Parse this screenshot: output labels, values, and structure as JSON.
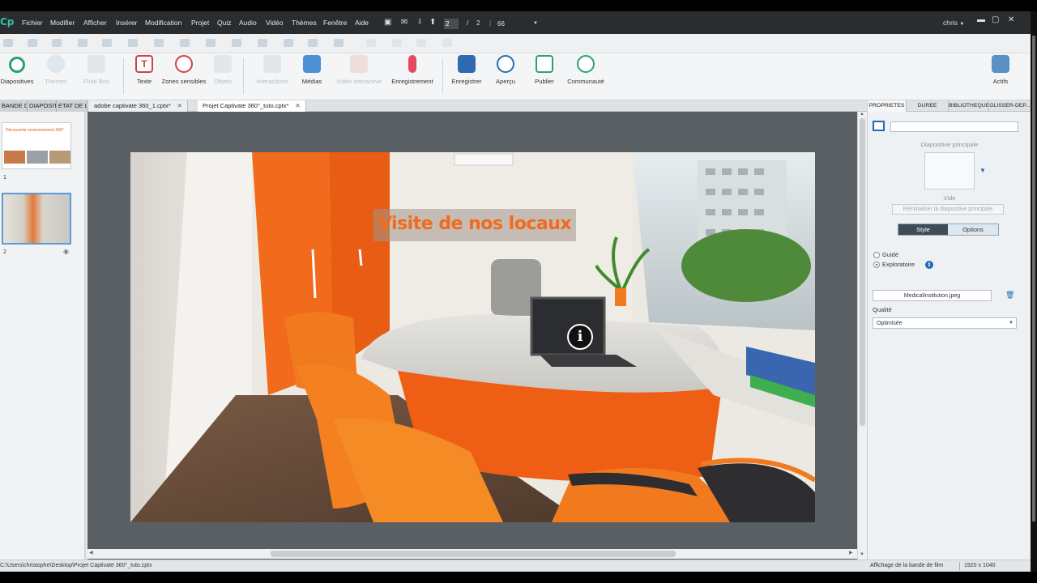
{
  "menubar": {
    "logo": "Cp",
    "items": [
      "Fichier",
      "Modifier",
      "Afficher",
      "Insérer",
      "Modification",
      "Projet",
      "Quiz",
      "Audio",
      "Vidéo",
      "Thèmes",
      "Fenêtre",
      "Aide"
    ],
    "slide_current": "2",
    "slide_sep": "/",
    "slide_total": "2",
    "zoom": "66",
    "user": "chris"
  },
  "toolbar": {
    "items": [
      {
        "label": "Diapositives",
        "icon": "add-slide-icon",
        "enabled": true
      },
      {
        "label": "Thèmes",
        "icon": "themes-icon",
        "enabled": false
      },
      {
        "label": "Fluid Box",
        "icon": "fluid-box-icon",
        "enabled": false
      },
      {
        "label": "Texte",
        "icon": "text-icon",
        "enabled": true
      },
      {
        "label": "Zones sensibles",
        "icon": "hotspot-icon",
        "enabled": true
      },
      {
        "label": "Objets",
        "icon": "objects-icon",
        "enabled": false
      },
      {
        "label": "Interactions",
        "icon": "interactions-icon",
        "enabled": false
      },
      {
        "label": "Médias",
        "icon": "media-icon",
        "enabled": true
      },
      {
        "label": "Vidéo interactive",
        "icon": "interactive-video-icon",
        "enabled": false
      },
      {
        "label": "Enregistrement",
        "icon": "microphone-icon",
        "enabled": true
      },
      {
        "label": "Enregistrer",
        "icon": "save-icon",
        "enabled": true
      },
      {
        "label": "Aperçu",
        "icon": "preview-icon",
        "enabled": true
      },
      {
        "label": "Publier",
        "icon": "publish-icon",
        "enabled": true
      },
      {
        "label": "Communauté",
        "icon": "community-icon",
        "enabled": true
      },
      {
        "label": "Actifs",
        "icon": "assets-icon",
        "enabled": true
      }
    ]
  },
  "panel_tabs": [
    "BANDE DE...",
    "DIAPOSIT...",
    "ETAT DE L..."
  ],
  "file_tabs": [
    {
      "label": "adobe captivate 360_1.cptx*",
      "active": false
    },
    {
      "label": "Projet Captivate 360°_tuto.cptx*",
      "active": true
    }
  ],
  "filmstrip": {
    "slides": [
      {
        "number": "1",
        "title": "Découverte environnement 360°"
      },
      {
        "number": "2"
      }
    ]
  },
  "slide": {
    "title": "Visite de nos locaux",
    "info_glyph": "i"
  },
  "properties": {
    "tabs": [
      "PROPRIETES",
      "DUREE",
      "BIBLIOTHEQUE",
      "GLISSER-DEP..."
    ],
    "master_label": "Diapositive principale",
    "master_value": "Vide",
    "reset_label": "Réinitialiser la diapositive principale",
    "seg_style": "Style",
    "seg_options": "Options",
    "radio_guided": "Guidé",
    "radio_explorer": "Exploratoire",
    "image_file": "MedicalInstitution.jpeg",
    "quality_label": "Qualité",
    "quality_value": "Optimisée"
  },
  "statusbar": {
    "path": "C:\\Users\\christophe\\Desktop\\Projet Captivate 360°_tuto.cptx",
    "mode": "Affichage de la bande de film",
    "size": "1920 x 1040"
  },
  "colors": {
    "accent": "#1f6ab8",
    "orange": "#f26a1b",
    "dark_bar": "#2a2d30"
  }
}
